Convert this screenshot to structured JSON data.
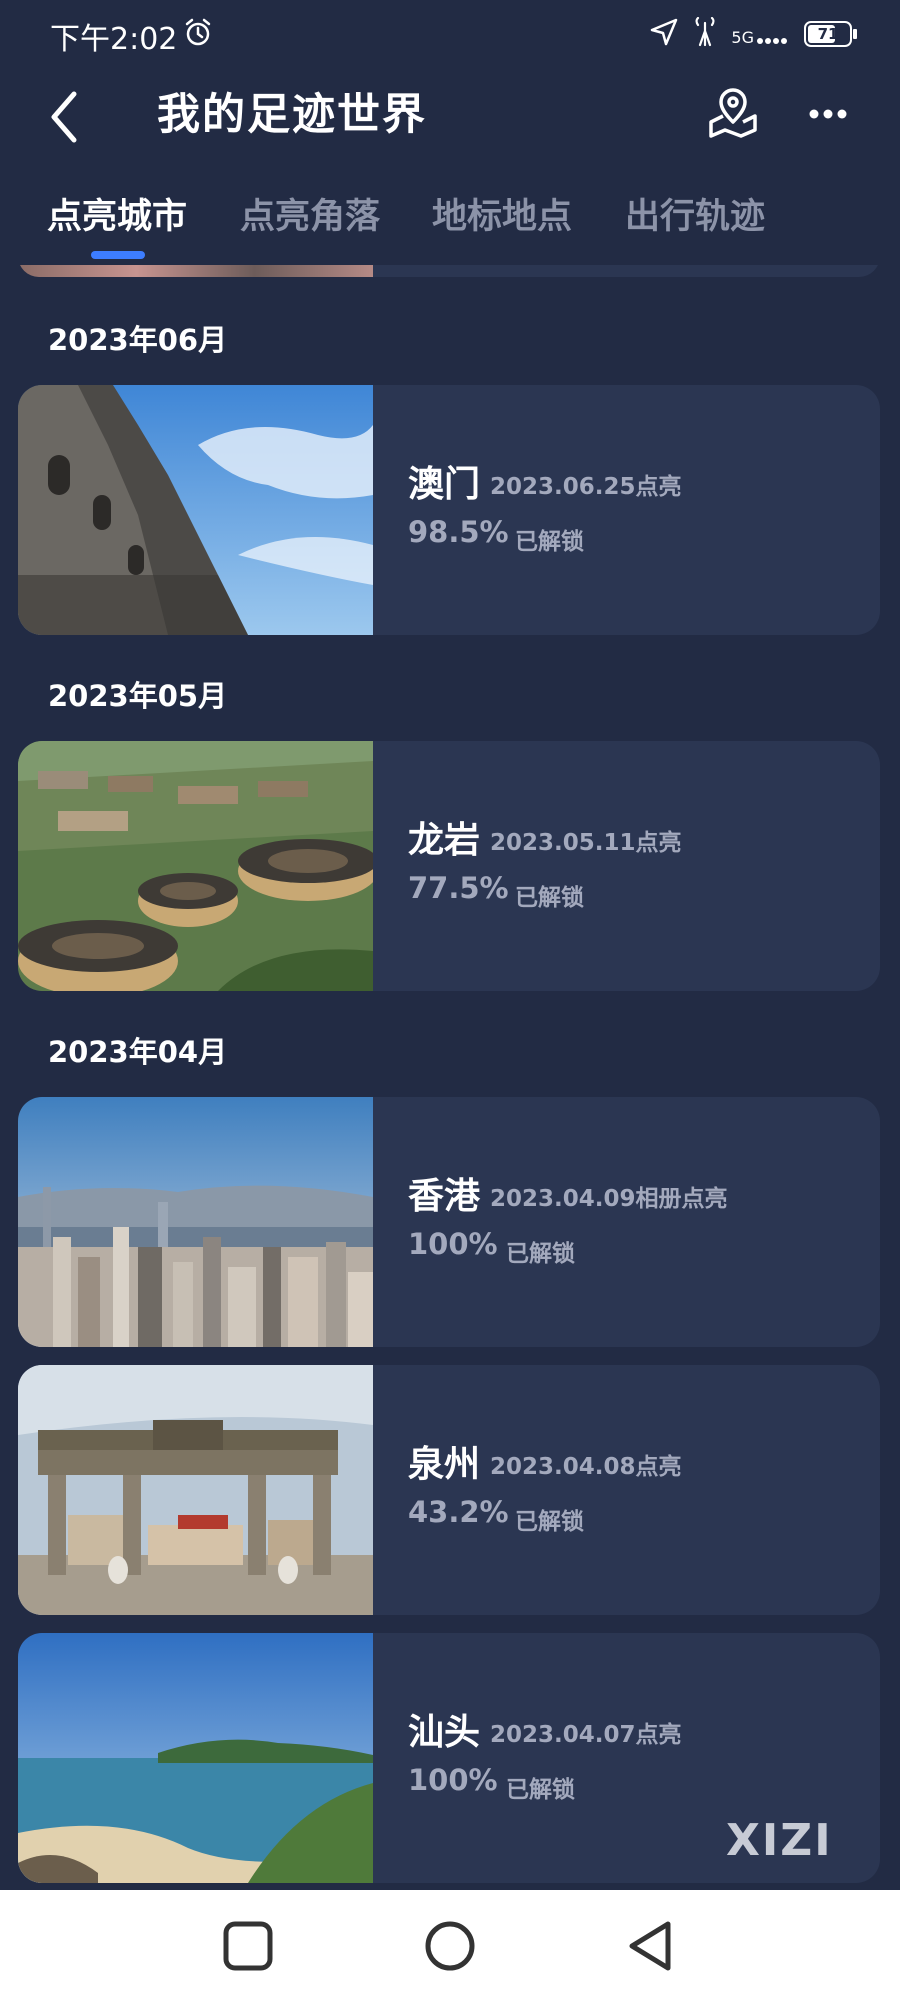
{
  "status_bar": {
    "time": "下午2:02",
    "network": "5G",
    "battery": "71",
    "battery_level": 0.71,
    "icons": [
      "alarm-icon",
      "location-arrow-icon",
      "signal-tower-icon",
      "cellular-signal-icon",
      "battery-icon"
    ]
  },
  "header": {
    "title": "我的足迹世界",
    "icons": [
      "back-arrow-icon",
      "map-pin-icon",
      "more-icon"
    ]
  },
  "tabs": [
    {
      "label": "点亮城市",
      "active": true
    },
    {
      "label": "点亮角落",
      "active": false
    },
    {
      "label": "地标地点",
      "active": false
    },
    {
      "label": "出行轨迹",
      "active": false
    }
  ],
  "groups": [
    {
      "month": "2023年06月",
      "cities": [
        {
          "name": "澳门",
          "date": "2023.06.25点亮",
          "percent": "98.5%",
          "unlock_label": "已解锁",
          "image": "macau-ruins-photo"
        }
      ]
    },
    {
      "month": "2023年05月",
      "cities": [
        {
          "name": "龙岩",
          "date": "2023.05.11点亮",
          "percent": "77.5%",
          "unlock_label": "已解锁",
          "image": "tulou-village-photo"
        }
      ]
    },
    {
      "month": "2023年04月",
      "cities": [
        {
          "name": "香港",
          "date": "2023.04.09相册点亮",
          "percent": "100%",
          "unlock_label": "已解锁",
          "image": "hongkong-skyline-photo"
        },
        {
          "name": "泉州",
          "date": "2023.04.08点亮",
          "percent": "43.2%",
          "unlock_label": "已解锁",
          "image": "quanzhou-archway-photo"
        },
        {
          "name": "汕头",
          "date": "2023.04.07点亮",
          "percent": "100%",
          "unlock_label": "已解锁",
          "image": "shantou-coast-photo"
        }
      ]
    }
  ],
  "watermark": "XIZI",
  "nav_bar": {
    "icons": [
      "recent-apps-icon",
      "home-icon",
      "back-icon"
    ]
  },
  "colors": {
    "background": "#222b44",
    "card": "#2b3652",
    "accent": "#3d7dff",
    "text_primary": "#ffffff",
    "text_secondary": "#a3a9bd",
    "tab_inactive": "#8c93a8"
  }
}
